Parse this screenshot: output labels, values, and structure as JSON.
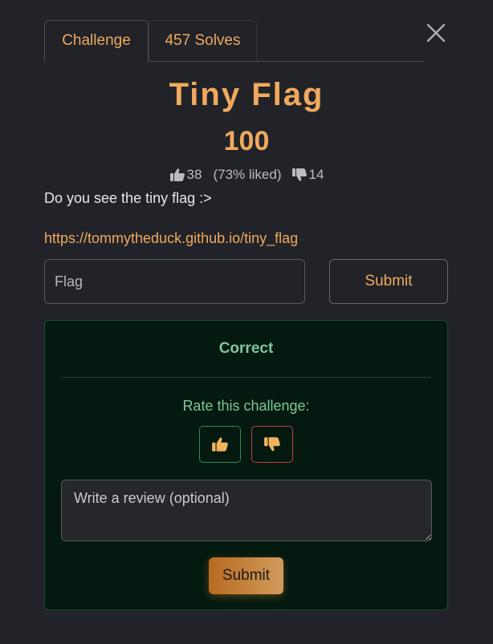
{
  "tabs": {
    "challenge_label": "Challenge",
    "solves_label": "457 Solves"
  },
  "challenge": {
    "name": "Tiny Flag",
    "points": "100",
    "likes": "38",
    "liked_pct": "(73% liked)",
    "dislikes": "14",
    "description": "Do you see the tiny flag :>",
    "link": "https://tommytheduck.github.io/tiny_flag"
  },
  "submission": {
    "flag_placeholder": "Flag",
    "submit_label": "Submit"
  },
  "result": {
    "status": "Correct",
    "rate_prompt": "Rate this challenge:",
    "review_placeholder": "Write a review (optional)",
    "review_submit_label": "Submit"
  },
  "icons": {
    "close": "close-icon",
    "like": "thumbs-up-icon",
    "dislike": "thumbs-down-icon"
  },
  "colors": {
    "accent": "#f0a95e",
    "success": "#7ec79b",
    "panel_bg": "#04190f",
    "danger": "#c2404a"
  }
}
